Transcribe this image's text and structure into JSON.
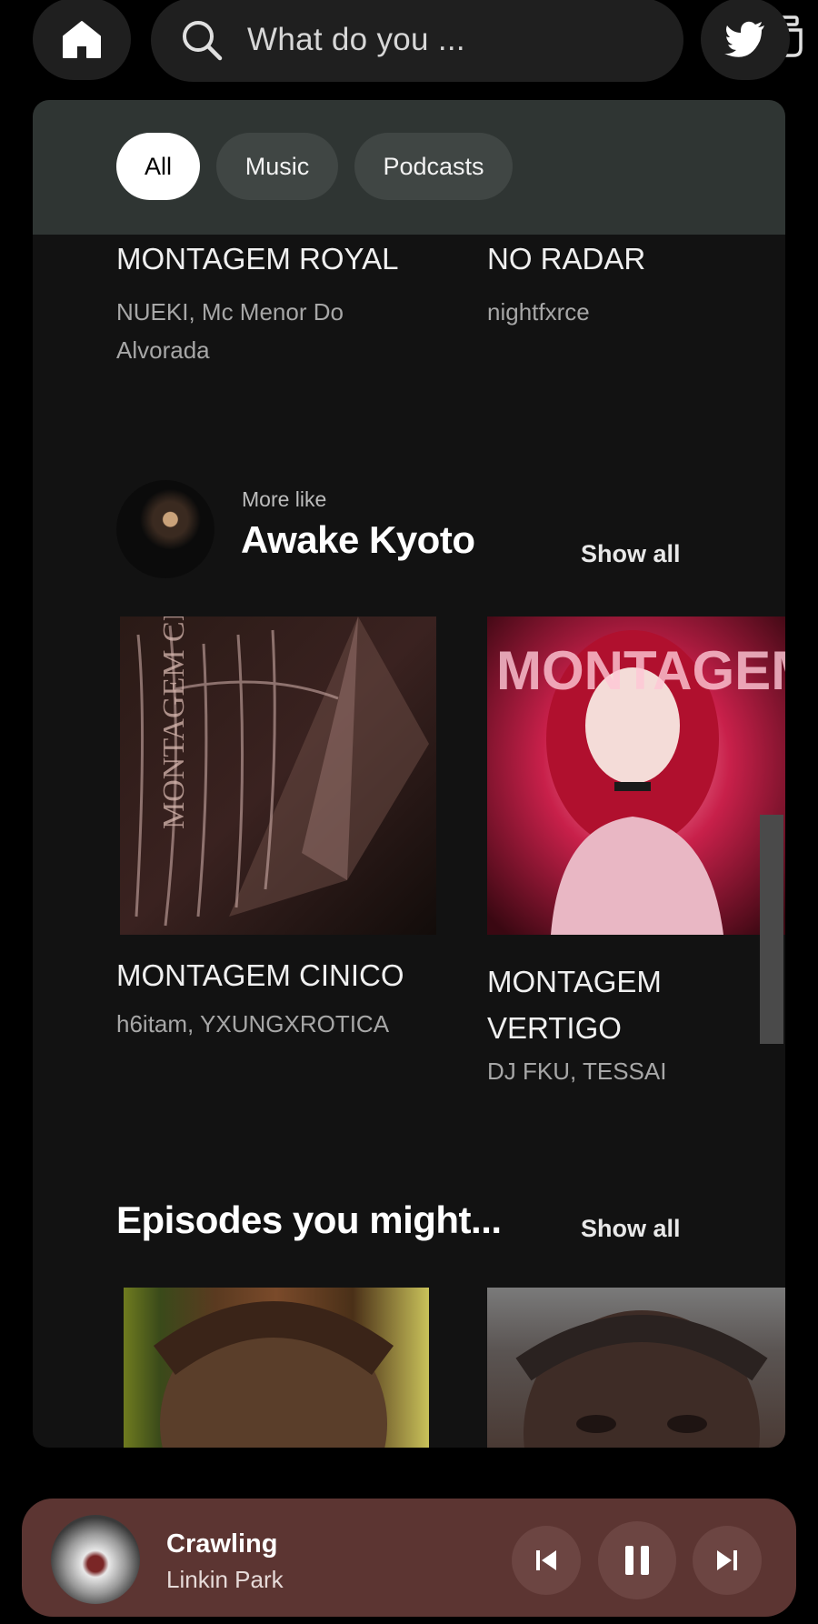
{
  "search": {
    "placeholder": "What do you ..."
  },
  "filters": [
    {
      "label": "All",
      "selected": true
    },
    {
      "label": "Music",
      "selected": false
    },
    {
      "label": "Podcasts",
      "selected": false
    }
  ],
  "top_row": [
    {
      "title": "MONTAGEM ROYAL",
      "artists": "NUEKI, Mc Menor Do Alvorada"
    },
    {
      "title": "NO RADAR",
      "artists": "nightfxrce"
    }
  ],
  "more_like": {
    "label": "More like",
    "artist": "Awake Kyoto",
    "show_all": "Show all",
    "items": [
      {
        "title": "MONTAGEM CINICO",
        "artists": "h6itam, YXUNGXROTICA",
        "art_text": "MONTAGEM CINICO"
      },
      {
        "title": "MONTAGEM VERTIGO",
        "artists": "DJ FKU, TESSAI",
        "art_text": "MONTAGEM"
      }
    ]
  },
  "episodes": {
    "title": "Episodes you might...",
    "show_all": "Show all"
  },
  "now_playing": {
    "track": "Crawling",
    "artist": "Linkin Park",
    "state": "playing"
  },
  "colors": {
    "player_bg": "#5c3532",
    "filter_bar": "#2f3533",
    "panel": "#121212"
  },
  "icons": [
    "home-icon",
    "search-icon",
    "lens-icon",
    "twitter-icon",
    "previous-icon",
    "pause-icon",
    "next-icon"
  ]
}
